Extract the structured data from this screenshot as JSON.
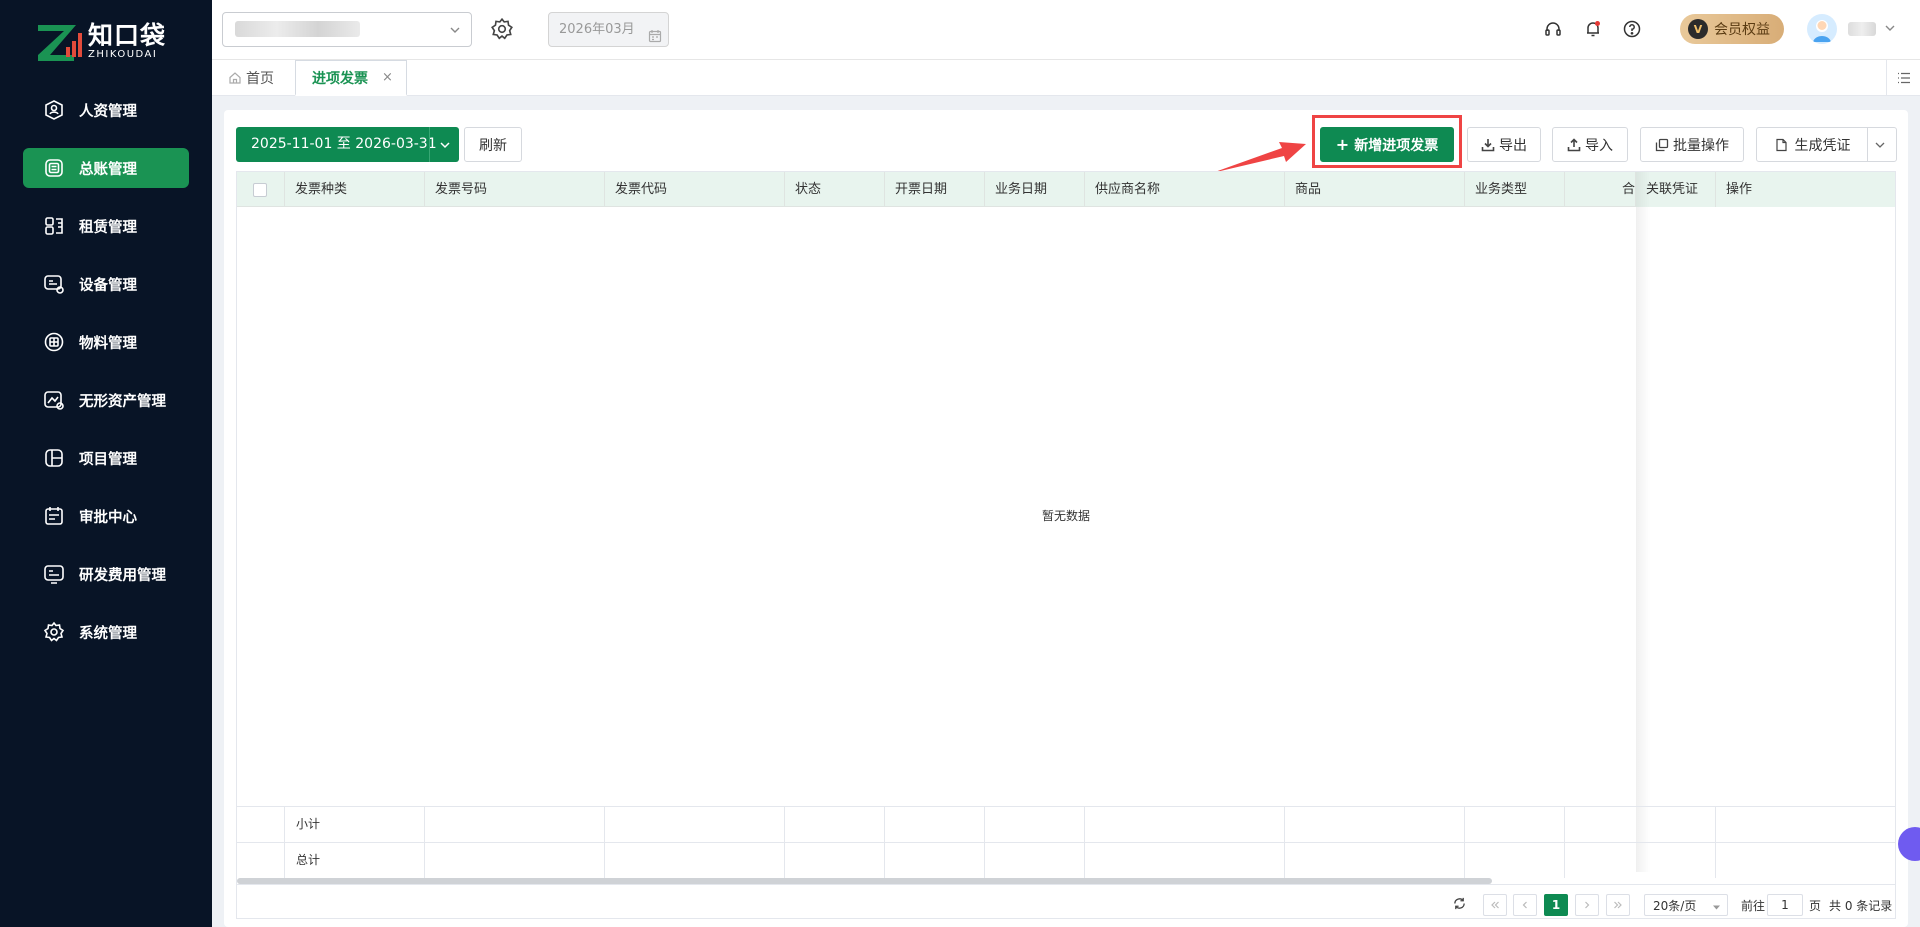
{
  "brand": {
    "name_cn": "知口袋",
    "name_en": "ZHIKOUDAI"
  },
  "sidebar": {
    "items": [
      {
        "label": "人资管理",
        "icon": "person-badge-icon",
        "active": false
      },
      {
        "label": "总账管理",
        "icon": "ledger-icon",
        "active": true
      },
      {
        "label": "租赁管理",
        "icon": "lease-icon",
        "active": false
      },
      {
        "label": "设备管理",
        "icon": "equipment-icon",
        "active": false
      },
      {
        "label": "物料管理",
        "icon": "material-icon",
        "active": false
      },
      {
        "label": "无形资产管理",
        "icon": "intangible-asset-icon",
        "active": false
      },
      {
        "label": "项目管理",
        "icon": "project-icon",
        "active": false
      },
      {
        "label": "审批中心",
        "icon": "approval-icon",
        "active": false
      },
      {
        "label": "研发费用管理",
        "icon": "rd-expense-icon",
        "active": false
      },
      {
        "label": "系统管理",
        "icon": "gear-icon",
        "active": false
      }
    ]
  },
  "header": {
    "period": "2026年03月",
    "vip_badge": "V",
    "vip_label": "会员权益"
  },
  "tabs": {
    "home": "首页",
    "active": "进项发票",
    "close": "×"
  },
  "toolbar": {
    "date_range": "2025-11-01 至 2026-03-31",
    "refresh": "刷新",
    "add": "新增进项发票",
    "export": "导出",
    "import": "导入",
    "batch": "批量操作",
    "voucher": "生成凭证"
  },
  "table": {
    "columns": [
      "发票种类",
      "发票号码",
      "发票代码",
      "状态",
      "开票日期",
      "业务日期",
      "供应商名称",
      "商品",
      "业务类型",
      "合",
      "关联凭证",
      "操作"
    ],
    "empty_text": "暂无数据",
    "subtotal": "小计",
    "total": "总计"
  },
  "pagination": {
    "current_page": "1",
    "page_size": "20条/页",
    "goto_label": "前往",
    "goto_value": "1",
    "page_unit": "页",
    "total_text": "共 0 条记录"
  },
  "colors": {
    "sidebar_bg": "#081426",
    "accent": "#0e8a52",
    "active_nav": "#1a9353",
    "highlight": "#ef4444"
  }
}
